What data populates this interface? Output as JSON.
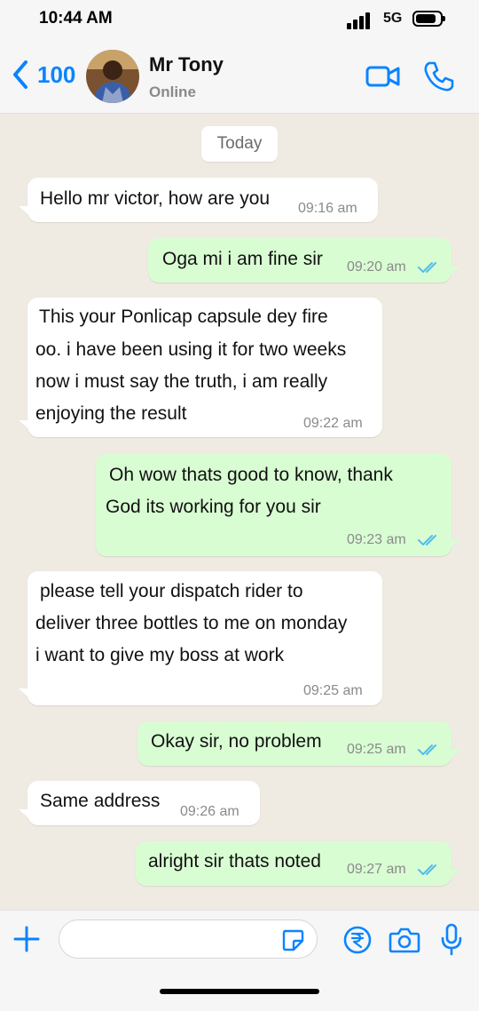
{
  "status_bar": {
    "time": "10:44 AM",
    "network": "5G"
  },
  "header": {
    "back_count": "100",
    "contact_name": "Mr Tony",
    "contact_status": "Online",
    "accent_color": "#0a84ff"
  },
  "chat": {
    "date_label": "Today",
    "messages": [
      {
        "direction": "in",
        "text": "Hello mr victor, how are you",
        "time": "09:16 am"
      },
      {
        "direction": "out",
        "text": "Oga mi i am fine sir",
        "time": "09:20 am",
        "status": "read"
      },
      {
        "direction": "in",
        "lines": [
          "This your Ponlicap capsule dey fire",
          "oo. i have been using it for two weeks",
          "now i must say the truth, i am really",
          "enjoying the result"
        ],
        "time": "09:22 am"
      },
      {
        "direction": "out",
        "lines": [
          "Oh wow thats good to know, thank",
          "God its working for you sir"
        ],
        "time": "09:23 am",
        "status": "read"
      },
      {
        "direction": "in",
        "lines": [
          "please tell your dispatch rider to",
          "deliver three bottles to me on monday",
          "i want to give my boss at work"
        ],
        "time": "09:25 am"
      },
      {
        "direction": "out",
        "text": "Okay sir, no problem",
        "time": "09:25 am",
        "status": "read"
      },
      {
        "direction": "in",
        "text": "Same address",
        "time": "09:26 am"
      },
      {
        "direction": "out",
        "text": "alright sir thats noted",
        "time": "09:27 am",
        "status": "read"
      }
    ],
    "incoming_color": "#ffffff",
    "outgoing_color": "#d9fdd3",
    "read_tick_color": "#53bdeb"
  },
  "input_bar": {
    "icons": [
      "plus-icon",
      "sticker-icon",
      "rupee-icon",
      "camera-icon",
      "microphone-icon"
    ]
  }
}
